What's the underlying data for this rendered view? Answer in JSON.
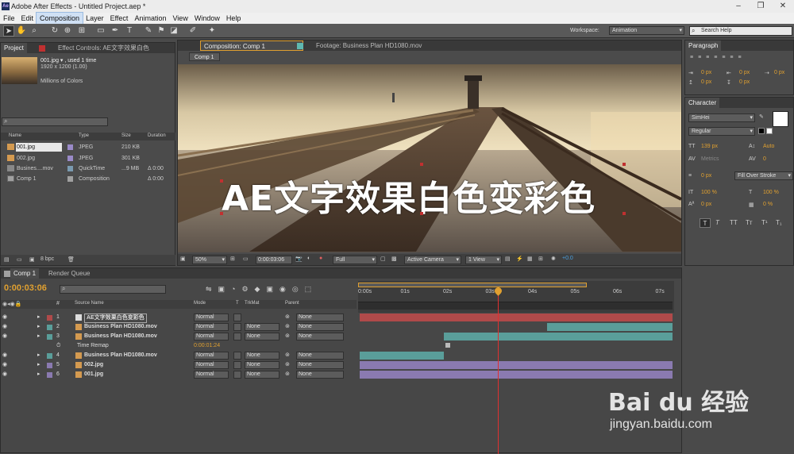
{
  "app": {
    "title": "Adobe After Effects - Untitled Project.aep *"
  },
  "menu": [
    "File",
    "Edit",
    "Composition",
    "Layer",
    "Effect",
    "Animation",
    "View",
    "Window",
    "Help"
  ],
  "menu_active": "Composition",
  "toolbar": {
    "workspace_label": "Workspace:",
    "workspace_value": "Animation",
    "search_placeholder": "Search Help"
  },
  "project": {
    "tab_project": "Project",
    "tab_effect": "Effect Controls: AE文字效果白色",
    "preview": {
      "name": "001.jpg ▾ , used 1 time",
      "dims": "1920 x 1200 (1.00)",
      "colors": "Millions of Colors"
    },
    "headers": [
      "Name",
      "Type",
      "Size",
      "Duration"
    ],
    "items": [
      {
        "name": "001.jpg",
        "type": "JPEG",
        "size": "210 KB",
        "duration": ""
      },
      {
        "name": "002.jpg",
        "type": "JPEG",
        "size": "301 KB",
        "duration": ""
      },
      {
        "name": "Busines....mov",
        "type": "QuickTime",
        "size": "...9 MB",
        "duration": "Δ 0:00"
      },
      {
        "name": "Comp 1",
        "type": "Composition",
        "size": "",
        "duration": "Δ 0:00"
      }
    ],
    "bpc": "8 bpc"
  },
  "comp": {
    "tab_comp": "Composition: Comp 1",
    "tab_footage": "Footage: Business Plan HD1080.mov",
    "comp_chip": "Comp 1",
    "overlay_text": "AE文字效果白色变彩色",
    "footer": {
      "zoom": "50%",
      "timecode": "0:00:03:06",
      "resolution": "Full",
      "camera": "Active Camera",
      "view": "1 View",
      "offset": "+0.0"
    }
  },
  "paragraph": {
    "title": "Paragraph",
    "px_values": [
      "0 px",
      "0 px",
      "0 px",
      "0 px",
      "0 px"
    ]
  },
  "character": {
    "title": "Character",
    "font": "SimHei",
    "style": "Regular",
    "size": "139 px",
    "leading": "Auto",
    "kerning": "Metrics",
    "tracking": "0",
    "stroke_width": "0 px",
    "stroke_type": "Fill Over Stroke",
    "vscale": "100 %",
    "hscale": "100 %",
    "baseline": "0 px",
    "tsume": "0 %",
    "styles": [
      "T",
      "T",
      "TT",
      "Tт",
      "T¹",
      "T₁"
    ]
  },
  "timeline": {
    "tab_comp": "Comp 1",
    "tab_render": "Render Queue",
    "timecode": "0:00:03:06",
    "col_headers": {
      "num": "#",
      "source": "Source Name",
      "mode": "Mode",
      "t": "T",
      "trkmat": "TrkMat",
      "parent": "Parent"
    },
    "ruler": [
      "0:00s",
      "01s",
      "02s",
      "03s",
      "04s",
      "05s",
      "06s",
      "07s"
    ],
    "layers": [
      {
        "num": "1",
        "name": "AE文字效果白色变彩色",
        "mode": "Normal",
        "trkmat": "",
        "parent": "None",
        "color": "#b04a4a"
      },
      {
        "num": "2",
        "name": "Business Plan HD1080.mov",
        "mode": "Normal",
        "trkmat": "None",
        "parent": "None",
        "color": "#5a9e9a"
      },
      {
        "num": "3",
        "name": "Business Plan HD1080.mov",
        "mode": "Normal",
        "trkmat": "None",
        "parent": "None",
        "color": "#5a9e9a"
      },
      {
        "num": "",
        "name": "Time Remap",
        "mode": "0:00:01:24",
        "trkmat": "",
        "parent": "",
        "color": ""
      },
      {
        "num": "4",
        "name": "Business Plan HD1080.mov",
        "mode": "Normal",
        "trkmat": "None",
        "parent": "None",
        "color": "#5a9e9a"
      },
      {
        "num": "5",
        "name": "002.jpg",
        "mode": "Normal",
        "trkmat": "None",
        "parent": "None",
        "color": "#8a7ab0"
      },
      {
        "num": "6",
        "name": "001.jpg",
        "mode": "Normal",
        "trkmat": "None",
        "parent": "None",
        "color": "#8a7ab0"
      }
    ]
  },
  "watermark": {
    "brand": "Bai du 经验",
    "url": "jingyan.baidu.com"
  }
}
